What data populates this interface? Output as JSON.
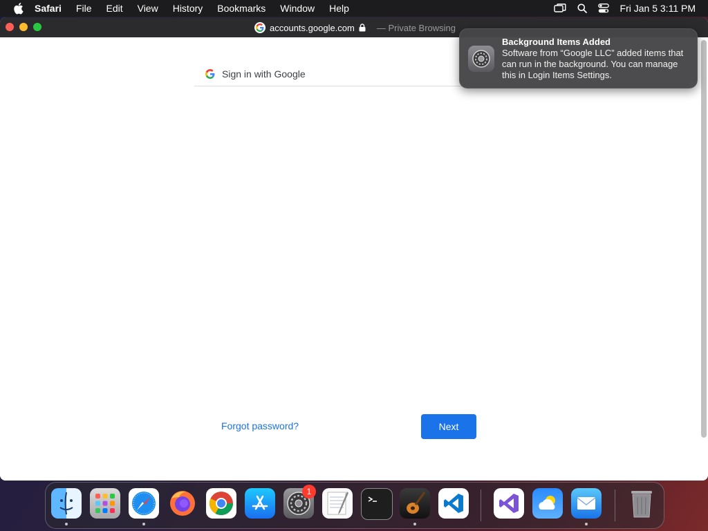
{
  "menubar": {
    "app": "Safari",
    "menus": [
      "File",
      "Edit",
      "View",
      "History",
      "Bookmarks",
      "Window",
      "Help"
    ],
    "clock": "Fri Jan 5  3:11 PM"
  },
  "window": {
    "url": "accounts.google.com",
    "mode": "— Private Browsing"
  },
  "page": {
    "header_label": "Sign in with Google",
    "forgot_label": "Forgot password?",
    "next_label": "Next"
  },
  "notification": {
    "title": "Background Items Added",
    "body": "Software from “Google LLC” added items that can run in the background. You can manage this in Login Items Settings."
  },
  "dock": {
    "apps": [
      {
        "name": "Finder",
        "icon": "finder-icon",
        "running": true
      },
      {
        "name": "Launchpad",
        "icon": "launchpad-icon",
        "running": false
      },
      {
        "name": "Safari",
        "icon": "safari-icon",
        "running": true
      },
      {
        "name": "Firefox",
        "icon": "firefox-icon",
        "running": false
      },
      {
        "name": "Google Chrome",
        "icon": "chrome-icon",
        "running": false
      },
      {
        "name": "App Store",
        "icon": "app-store-icon",
        "running": false
      },
      {
        "name": "System Settings",
        "icon": "system-settings-icon",
        "running": false,
        "badge": "1"
      },
      {
        "name": "TextEdit",
        "icon": "textedit-icon",
        "running": false
      },
      {
        "name": "Terminal",
        "icon": "terminal-icon",
        "running": false
      },
      {
        "name": "GarageBand",
        "icon": "garageband-icon",
        "running": true
      },
      {
        "name": "Visual Studio Code",
        "icon": "vscode-icon",
        "running": false
      },
      {
        "name": "Visual Studio",
        "icon": "visual-studio-icon",
        "running": false
      },
      {
        "name": "Weather",
        "icon": "weather-icon",
        "running": false
      },
      {
        "name": "Mail",
        "icon": "mail-icon",
        "running": true
      },
      {
        "name": "Trash",
        "icon": "trash-icon",
        "running": false
      }
    ]
  }
}
